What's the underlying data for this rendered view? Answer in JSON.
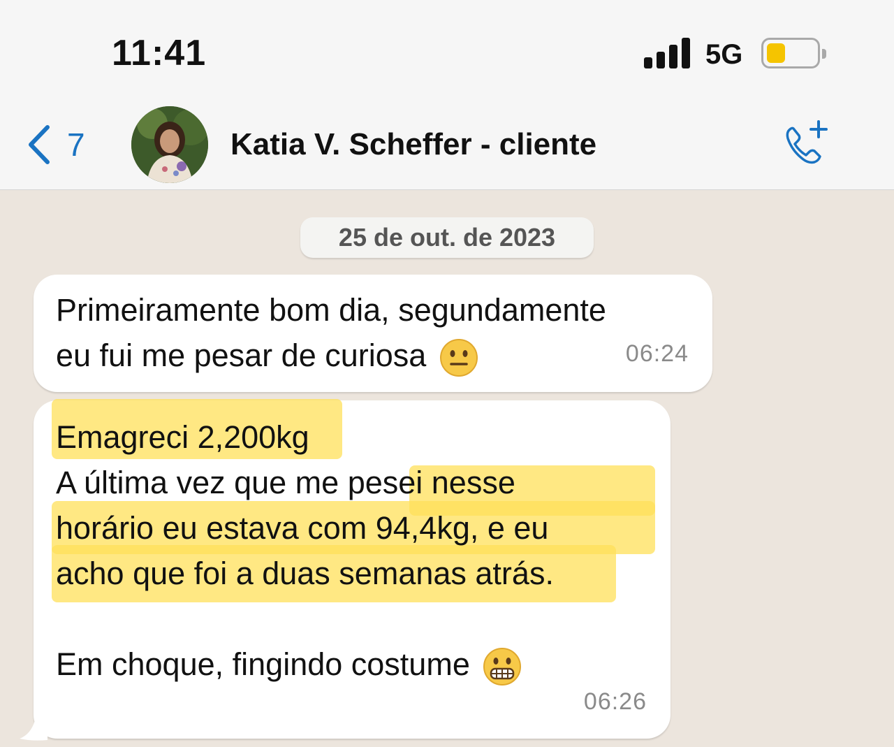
{
  "status_bar": {
    "time": "11:41",
    "network": "5G",
    "battery_level": 0.3,
    "battery_color": "#f5c400"
  },
  "header": {
    "back_icon": "chevron-left-icon",
    "unread_count": "7",
    "contact_name": "Katia V. Scheffer - cliente",
    "call_icon": "add-call-icon",
    "accent_color": "#1a73c2"
  },
  "chat": {
    "date": "25 de out. de 2023",
    "messages": [
      {
        "lines": [
          "Primeiramente bom dia, segundamente",
          "eu fui me pesar de curiosa"
        ],
        "emoji": "neutral-face-emoji",
        "time": "06:24"
      },
      {
        "lines": [
          "Emagreci 2,200kg",
          "A última vez que me pesei nesse",
          "horário eu estava com 94,4kg, e eu",
          "acho que foi a duas semanas atrás.",
          "",
          "Em choque, fingindo costume"
        ],
        "emoji": "grimacing-face-emoji",
        "time": "06:26",
        "highlight_color": "#ffe05a"
      }
    ]
  }
}
